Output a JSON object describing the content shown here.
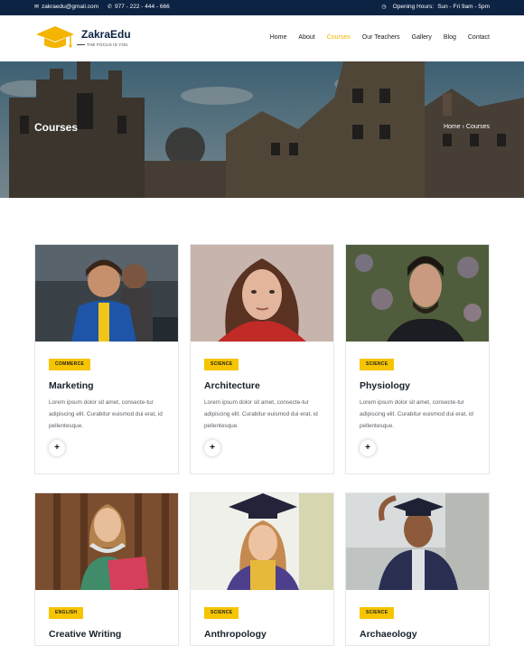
{
  "topbar": {
    "email": "zakraedu@gmail.com",
    "phone": "977 - 222 - 444 - 666",
    "hours_label": "Opening Hours:",
    "hours_value": "Sun - Fri  9am - 5pm",
    "icons": [
      "envelope-icon",
      "phone-icon",
      "clock-icon"
    ]
  },
  "logo": {
    "brand": "ZakraEdu",
    "tagline": "THE FOCUS IS YOU"
  },
  "nav": [
    "Home",
    "About",
    "Courses",
    "Our Teachers",
    "Gallery",
    "Blog",
    "Contact"
  ],
  "nav_active": "Courses",
  "hero": {
    "title": "Courses",
    "breadcrumb_home": "Home",
    "breadcrumb_sep": "›",
    "breadcrumb_current": "Courses"
  },
  "colors": {
    "navy": "#0c2344",
    "accent": "#f4b400",
    "badge": "#f7c400"
  },
  "cards": [
    {
      "badge": "COMMERCE",
      "title": "Marketing",
      "desc": "Lorem ipsum dolor sit amet, consecte-tur adipiscing elit. Curabitur euismod dui erat, id pellentesque.",
      "plus": "+"
    },
    {
      "badge": "SCIENCE",
      "title": "Architecture",
      "desc": "Lorem ipsum dolor sit amet, consecte-tur adipiscing elit. Curabitur euismod dui erat, id pellentesque.",
      "plus": "+"
    },
    {
      "badge": "SCIENCE",
      "title": "Physiology",
      "desc": "Lorem ipsum dolor sit amet, consecte-tur adipiscing elit. Curabitur euismod dui erat, id pellentesque.",
      "plus": "+"
    },
    {
      "badge": "ENGLISH",
      "title": "Creative Writing"
    },
    {
      "badge": "SCIENCE",
      "title": "Anthropology"
    },
    {
      "badge": "SCIENCE",
      "title": "Archaeology"
    }
  ]
}
